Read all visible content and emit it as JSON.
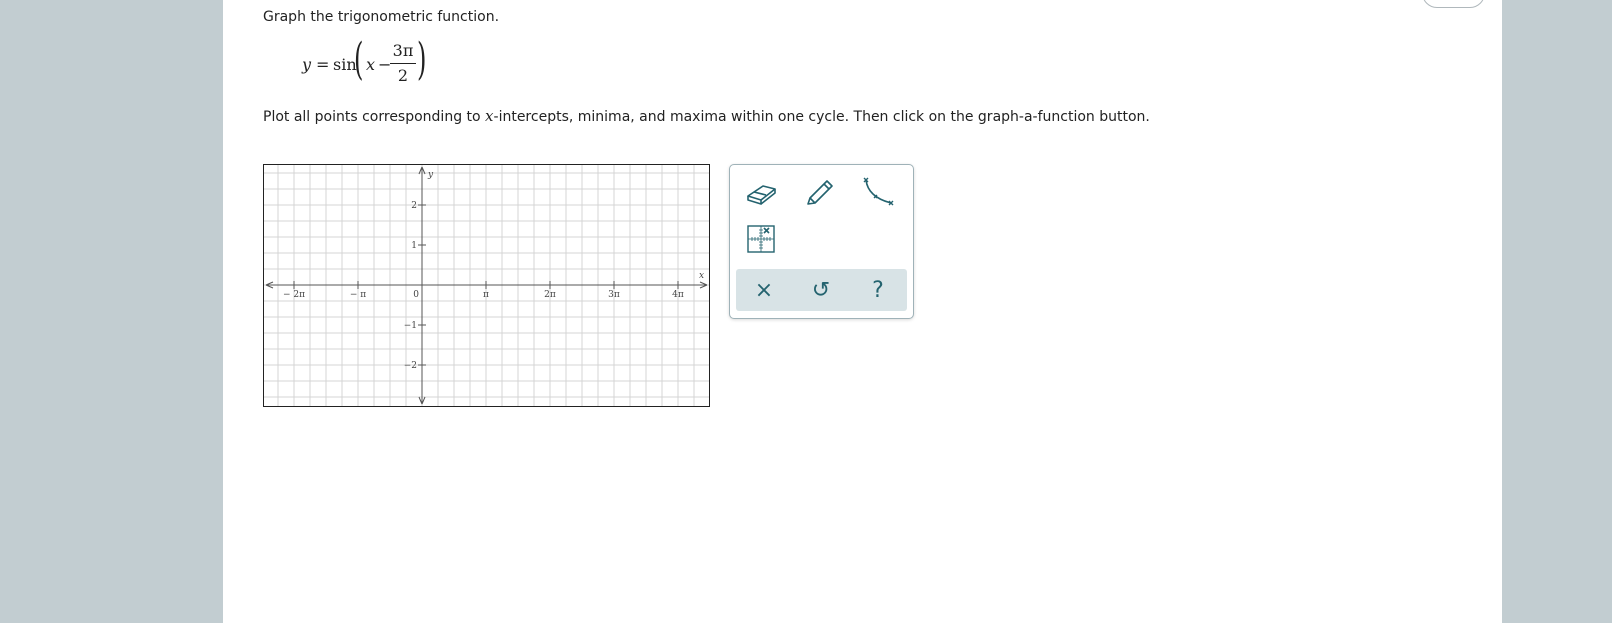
{
  "question": {
    "instruction": "Graph the trigonometric function.",
    "equation": {
      "lhs": "y",
      "equals": "=",
      "func": "sin",
      "var": "x",
      "minus": "−",
      "numerator": "3π",
      "denominator": "2"
    },
    "plot_instruction": {
      "before": "Plot all points corresponding to ",
      "var": "x",
      "after": "-intercepts, minima, and maxima within one cycle. Then click on the graph-a-function button."
    }
  },
  "graph": {
    "x_axis_label": "x",
    "y_axis_label": "y",
    "x_tick_labels": [
      "− 2π",
      "− π",
      "0",
      "π",
      "2π",
      "3π",
      "4π"
    ],
    "y_tick_labels": [
      "2",
      "1",
      "−1",
      "−2"
    ]
  },
  "toolbox": {
    "tools": [
      {
        "name": "eraser-tool",
        "icon": "eraser-icon"
      },
      {
        "name": "pencil-tool",
        "icon": "pencil-icon"
      },
      {
        "name": "graph-a-function-tool",
        "icon": "curve-icon"
      },
      {
        "name": "point-tool",
        "icon": "grid-point-icon"
      }
    ],
    "actions": {
      "clear": "×",
      "undo": "↺",
      "help": "?"
    }
  },
  "colors": {
    "page_background": "#c2cdd1",
    "panel_background": "#ffffff",
    "icon_teal": "#24636f",
    "action_bar": "#d8e3e6",
    "grid_line": "#d4d4d4"
  }
}
